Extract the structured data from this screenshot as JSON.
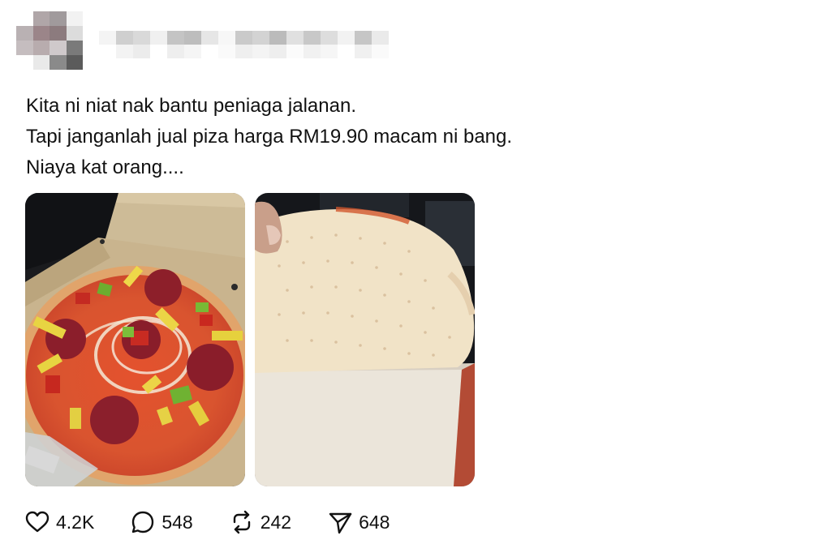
{
  "post": {
    "text_lines": [
      "Kita ni niat nak bantu peniaga jalanan.",
      "Tapi janganlah jual piza harga RM19.90 macam ni bang.",
      "Niaya kat orang...."
    ],
    "media": [
      {
        "icon": "pizza-top-photo"
      },
      {
        "icon": "pizza-base-underside-photo"
      }
    ]
  },
  "actions": {
    "like": {
      "icon": "heart-icon",
      "count": "4.2K"
    },
    "reply": {
      "icon": "comment-bubble-icon",
      "count": "548"
    },
    "repost": {
      "icon": "repost-icon",
      "count": "242"
    },
    "share": {
      "icon": "send-icon",
      "count": "648"
    }
  },
  "colors": {
    "text": "#111111",
    "background": "#ffffff",
    "icon": "#111111"
  }
}
